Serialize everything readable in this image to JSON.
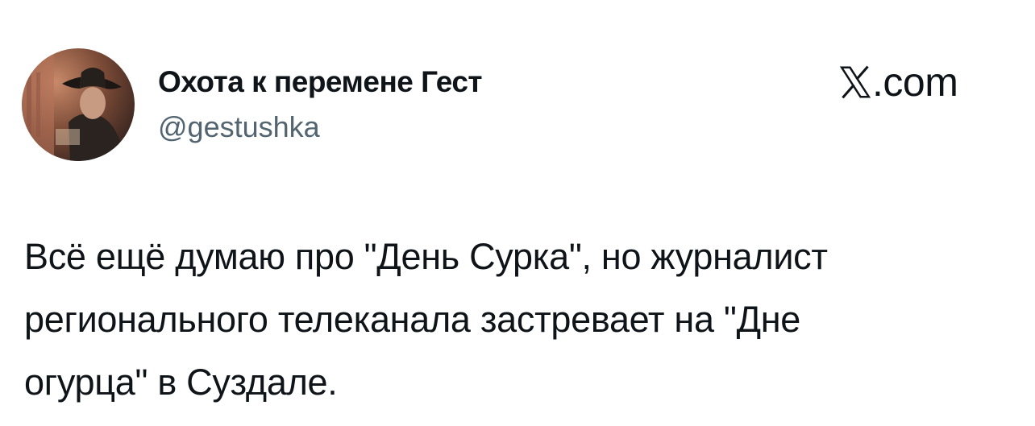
{
  "author": {
    "display_name": "Охота к перемене Гест",
    "handle": "@gestushka",
    "avatar_icon": "profile-photo-cowboy-hat"
  },
  "brand": {
    "logo_icon": "x-logo-icon",
    "suffix": ".com"
  },
  "tweet": {
    "text": "Всё ещё думаю про \"День Сурка\", но журналист\nрегионального телеканала застревает на \"Дне\nогурца\" в Суздале."
  },
  "colors": {
    "text": "#0f1419",
    "secondary_text": "#536471",
    "background": "#ffffff"
  }
}
